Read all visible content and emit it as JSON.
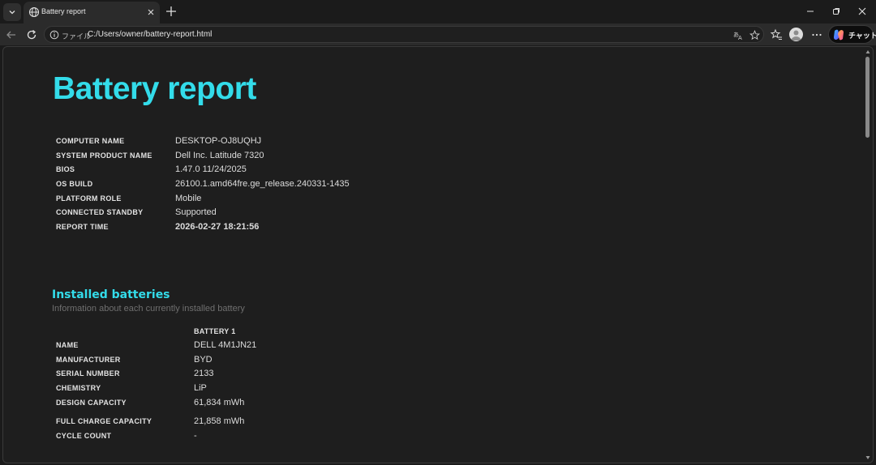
{
  "browser": {
    "tab": {
      "title": "Battery report"
    },
    "address": {
      "scheme_label": "ファイル",
      "url": "C:/Users/owner/battery-report.html"
    },
    "chat_label": "チャット"
  },
  "report": {
    "title": "Battery report",
    "system_info": [
      {
        "label": "COMPUTER NAME",
        "value": "DESKTOP-OJ8UQHJ"
      },
      {
        "label": "SYSTEM PRODUCT NAME",
        "value": "Dell Inc. Latitude 7320"
      },
      {
        "label": "BIOS",
        "value": "1.47.0 11/24/2025"
      },
      {
        "label": "OS BUILD",
        "value": "26100.1.amd64fre.ge_release.240331-1435"
      },
      {
        "label": "PLATFORM ROLE",
        "value": "Mobile"
      },
      {
        "label": "CONNECTED STANDBY",
        "value": "Supported"
      },
      {
        "label": "REPORT TIME",
        "value": "2026-02-27  18:21:56"
      }
    ],
    "installed_batteries": {
      "title": "Installed batteries",
      "subtitle": "Information about each currently installed battery",
      "column_header": "BATTERY 1",
      "rows": [
        {
          "label": "NAME",
          "value": "DELL 4M1JN21"
        },
        {
          "label": "MANUFACTURER",
          "value": "BYD"
        },
        {
          "label": "SERIAL NUMBER",
          "value": "2133"
        },
        {
          "label": "CHEMISTRY",
          "value": "LiP"
        },
        {
          "label": "DESIGN CAPACITY",
          "value": "61,834 mWh"
        },
        {
          "label": "FULL CHARGE CAPACITY",
          "value": "21,858 mWh"
        },
        {
          "label": "CYCLE COUNT",
          "value": "-"
        }
      ]
    }
  },
  "colors": {
    "accent": "#33dcea",
    "background": "#1e1e1e",
    "chrome": "#2b2b2b"
  },
  "icons": [
    "tab-menu-chevron-icon",
    "globe-icon",
    "close-icon",
    "plus-icon",
    "minimize-icon",
    "restore-icon",
    "close-window-icon",
    "back-icon",
    "reload-icon",
    "info-icon",
    "translate-icon",
    "star-icon",
    "favorites-icon",
    "more-icon",
    "copilot-icon"
  ]
}
